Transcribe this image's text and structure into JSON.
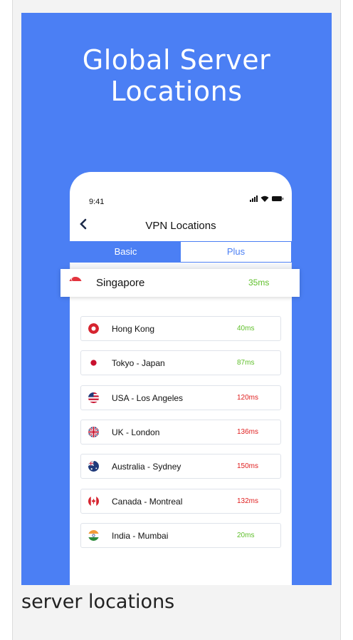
{
  "hero": {
    "title_line1": "Global Server",
    "title_line2": "Locations"
  },
  "status_bar": {
    "time": "9:41"
  },
  "nav": {
    "back_icon": "chevron-left-icon",
    "title": "VPN Locations"
  },
  "tabs": [
    {
      "label": "Basic",
      "active": true
    },
    {
      "label": "Plus",
      "active": false
    }
  ],
  "selected": {
    "name": "Singapore",
    "latency": "35ms",
    "flag": "singapore-flag-icon",
    "color": "#5fbf2a"
  },
  "locations": [
    {
      "name": "Hong Kong",
      "latency": "40ms",
      "flag": "hong-kong-flag-icon",
      "color": "#5fbf2a"
    },
    {
      "name": "Tokyo - Japan",
      "latency": "87ms",
      "flag": "japan-flag-icon",
      "color": "#5fbf2a"
    },
    {
      "name": "USA - Los Angeles",
      "latency": "120ms",
      "flag": "usa-flag-icon",
      "color": "#e02020"
    },
    {
      "name": "UK - London",
      "latency": "136ms",
      "flag": "uk-flag-icon",
      "color": "#e02020"
    },
    {
      "name": "Australia - Sydney",
      "latency": "150ms",
      "flag": "australia-flag-icon",
      "color": "#e02020"
    },
    {
      "name": "Canada - Montreal",
      "latency": "132ms",
      "flag": "canada-flag-icon",
      "color": "#e02020"
    },
    {
      "name": "India - Mumbai",
      "latency": "20ms",
      "flag": "india-flag-icon",
      "color": "#5fbf2a"
    }
  ],
  "caption": "server locations",
  "colors": {
    "accent": "#4b7ff4",
    "good": "#5fbf2a",
    "bad": "#e02020"
  }
}
